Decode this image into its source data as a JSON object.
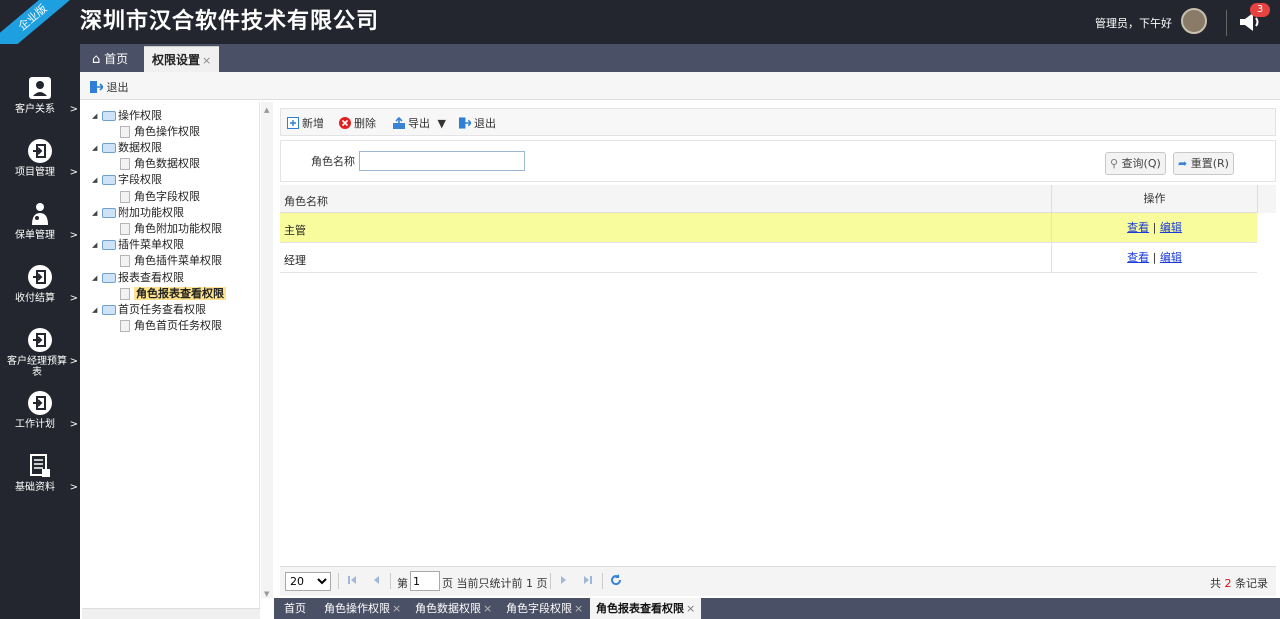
{
  "header": {
    "ribbon": "企业版",
    "company": "深圳市汉合软件技术有限公司",
    "greeting": "管理员，下午好",
    "notification_count": "3"
  },
  "nav": [
    {
      "label": "客户关系",
      "icon": "user-icon"
    },
    {
      "label": "项目管理",
      "icon": "enter-icon"
    },
    {
      "label": "保单管理",
      "icon": "person-key-icon"
    },
    {
      "label": "收付结算",
      "icon": "enter-icon"
    },
    {
      "label": "客户经理预算表",
      "icon": "enter-icon"
    },
    {
      "label": "工作计划",
      "icon": "enter-icon"
    },
    {
      "label": "基础资料",
      "icon": "document-icon"
    }
  ],
  "tabs": {
    "home": "首页",
    "active": "权限设置"
  },
  "toolbar": {
    "exit": "退出"
  },
  "tree": {
    "groups": [
      {
        "label": "操作权限",
        "child": "角色操作权限"
      },
      {
        "label": "数据权限",
        "child": "角色数据权限"
      },
      {
        "label": "字段权限",
        "child": "角色字段权限"
      },
      {
        "label": "附加功能权限",
        "child": "角色附加功能权限"
      },
      {
        "label": "插件菜单权限",
        "child": "角色插件菜单权限"
      },
      {
        "label": "报表查看权限",
        "child": "角色报表查看权限"
      },
      {
        "label": "首页任务查看权限",
        "child": "角色首页任务权限"
      }
    ],
    "selected_index": 5
  },
  "grid_toolbar": {
    "add": "新增",
    "delete": "删除",
    "export": "导出",
    "exit": "退出"
  },
  "search": {
    "label": "角色名称",
    "value": "",
    "query": "查询(Q)",
    "reset": "重置(R)"
  },
  "grid": {
    "columns": {
      "name": "角色名称",
      "op": "操作"
    },
    "rows": [
      {
        "name": "主管",
        "view": "查看",
        "edit": "编辑"
      },
      {
        "name": "经理",
        "view": "查看",
        "edit": "编辑"
      }
    ],
    "separator": "|"
  },
  "pager": {
    "page_size": "20",
    "page_prefix": "第",
    "page": "1",
    "page_suffix": "页 当前只统计前 1 页",
    "total_prefix": "共",
    "total": "2",
    "total_suffix": "条记录"
  },
  "bottom_tabs": [
    {
      "label": "首页",
      "closable": false
    },
    {
      "label": "角色操作权限",
      "closable": true
    },
    {
      "label": "角色数据权限",
      "closable": true
    },
    {
      "label": "角色字段权限",
      "closable": true
    },
    {
      "label": "角色报表查看权限",
      "closable": true,
      "active": true
    }
  ],
  "colors": {
    "header_bg": "#23262e",
    "tabbar_bg": "#4a5065",
    "selected_row": "#f8fc9c",
    "ribbon": "#1e9fe0",
    "badge": "#e64340"
  }
}
